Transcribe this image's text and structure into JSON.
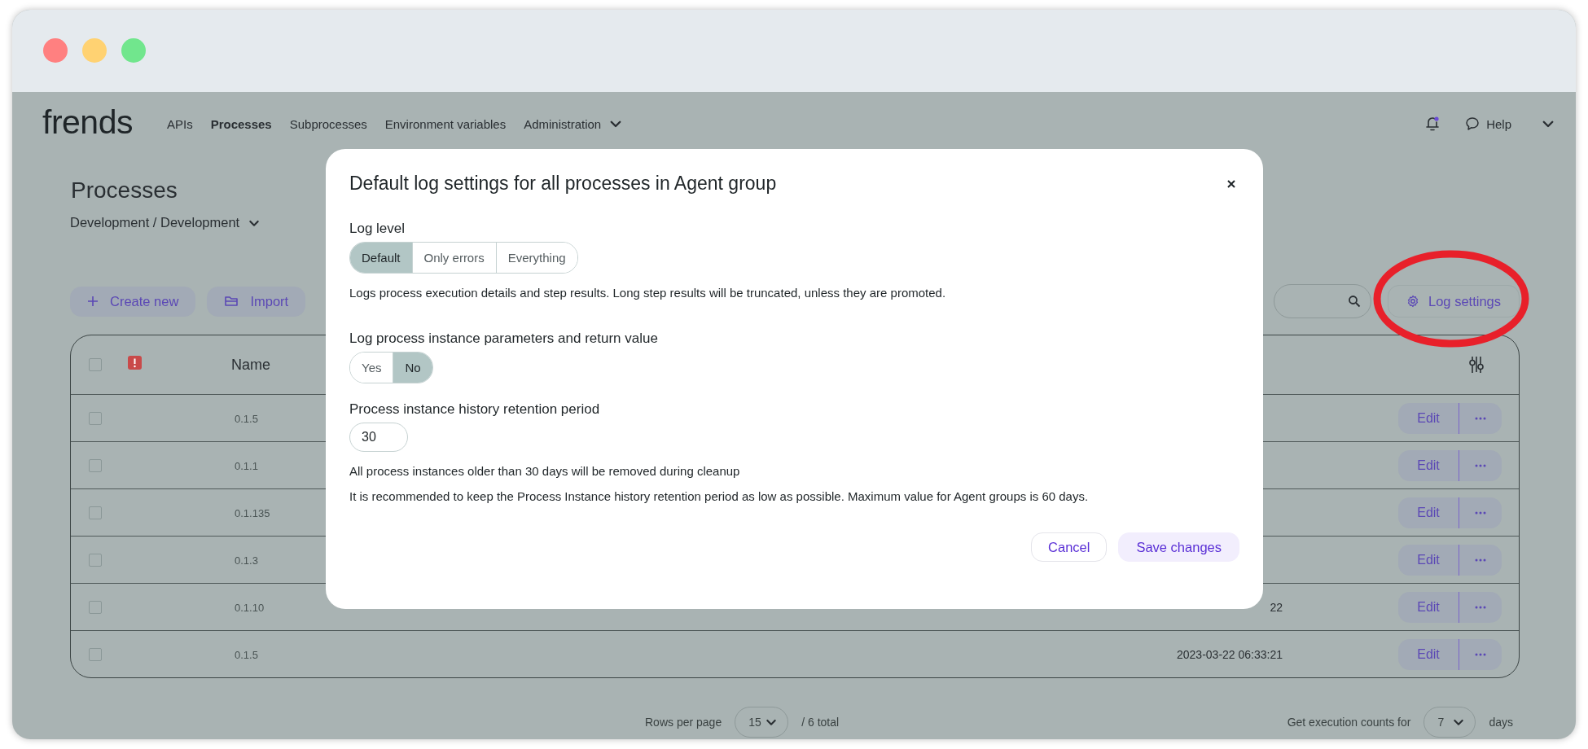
{
  "nav": {
    "logo": "frends",
    "items": [
      {
        "label": "APIs",
        "selected": false,
        "has_menu": false
      },
      {
        "label": "Processes",
        "selected": true,
        "has_menu": false
      },
      {
        "label": "Subprocesses",
        "selected": false,
        "has_menu": false
      },
      {
        "label": "Environment variables",
        "selected": false,
        "has_menu": false
      },
      {
        "label": "Administration",
        "selected": false,
        "has_menu": true
      }
    ],
    "notifications": {
      "unread": true
    },
    "help": "Help"
  },
  "page": {
    "title": "Processes",
    "environment": "Development / Development",
    "actions": [
      {
        "label": "Create new",
        "kind": "create"
      },
      {
        "label": "Import",
        "kind": "import"
      }
    ],
    "log_settings": "Log settings"
  },
  "table": {
    "header": {
      "checked": false,
      "name": "Name"
    },
    "rows": [
      {
        "checked": false,
        "name": "0.1.5",
        "edit": "Edit"
      },
      {
        "checked": false,
        "name": "0.1.1",
        "edit": "Edit"
      },
      {
        "checked": false,
        "name": "0.1.135",
        "edit": "Edit"
      },
      {
        "checked": false,
        "name": "0.1.3",
        "edit": "Edit"
      },
      {
        "checked": false,
        "name": "0.1.10",
        "column_4": "22",
        "edit": "Edit"
      },
      {
        "checked": false,
        "name": "0.1.5",
        "column_4": "2023-03-22 06:33:21",
        "edit": "Edit"
      }
    ]
  },
  "pagination": {
    "rows_label": "Rows per page",
    "rows_value": "15",
    "total": "/ 6 total",
    "counts_label": "Get execution counts for",
    "counts_value": "7",
    "counts_unit": "days"
  },
  "dialog": {
    "title": "Default log settings for all processes in Agent group",
    "log_level": {
      "label": "Log level",
      "options": [
        {
          "label": "Default",
          "selected": true
        },
        {
          "label": "Only errors",
          "selected": false
        },
        {
          "label": "Everything",
          "selected": false
        }
      ],
      "description": "Logs process execution details and step results. Long step results will be truncated, unless they are promoted."
    },
    "log_parameters": {
      "label": "Log process instance parameters and return value",
      "options": [
        {
          "label": "Yes",
          "selected": false
        },
        {
          "label": "No",
          "selected": true
        }
      ]
    },
    "retention": {
      "label": "Process instance history retention period",
      "value": "30",
      "notes": [
        "All process instances older than 30 days will be removed during cleanup",
        "It is recommended to keep the Process Instance history retention period as low as possible. Maximum value for Agent groups is 60 days."
      ]
    },
    "buttons": [
      {
        "label": "Cancel",
        "kind": "secondary"
      },
      {
        "label": "Save changes",
        "kind": "primary"
      }
    ]
  }
}
